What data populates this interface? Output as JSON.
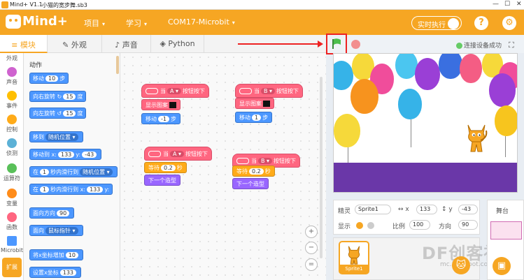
{
  "window": {
    "app_name": "Mind+ V1.1",
    "file_name": "小猫的宽步舞.sb3",
    "min": "—",
    "max": "☐",
    "close": "✕"
  },
  "menubar": {
    "logo": "Mind+",
    "items": [
      {
        "label": "项目",
        "caret": "▾"
      },
      {
        "label": "学习",
        "caret": "▾"
      },
      {
        "label": "COM17-Microbit",
        "caret": "▾"
      }
    ],
    "realtime_label": "实时执行",
    "help": "?",
    "settings": "⚙"
  },
  "tabs": [
    {
      "label": "模块",
      "icon": "≡"
    },
    {
      "label": "外观",
      "icon": "✎"
    },
    {
      "label": "声音",
      "icon": "♪"
    },
    {
      "label": "Python",
      "icon": "◈"
    }
  ],
  "stage_toolbar": {
    "connected": "连接设备成功",
    "fullscreen": "⛶"
  },
  "categories": [
    {
      "label": "外观",
      "color": "#9966ff"
    },
    {
      "label": "声音",
      "color": "#cf63cf"
    },
    {
      "label": "事件",
      "color": "#ffbf00"
    },
    {
      "label": "控制",
      "color": "#ffab19"
    },
    {
      "label": "侦测",
      "color": "#5cb1d6"
    },
    {
      "label": "运算符",
      "color": "#59c059"
    },
    {
      "label": "变量",
      "color": "#ff8c1a"
    },
    {
      "label": "函数",
      "color": "#ff6680"
    },
    {
      "label": "Microbit",
      "color": "#4c97ff"
    }
  ],
  "expand_label": "扩展",
  "palette": {
    "title": "动作",
    "blocks": [
      {
        "pre": "移动",
        "val": "10",
        "post": "步"
      },
      {
        "pre": "向右旋转 ↻",
        "val": "15",
        "post": "度"
      },
      {
        "pre": "向左旋转 ↺",
        "val": "15",
        "post": "度"
      },
      {
        "pre": "移到",
        "dd": "随机位置 ▾"
      },
      {
        "pre": "移动到 x:",
        "val": "133",
        "post": "y:",
        "val2": "-43"
      },
      {
        "pre": "在",
        "val": "1",
        "post": "秒内滑行到",
        "dd": "随机位置 ▾"
      },
      {
        "pre": "在",
        "val": "1",
        "post": "秒内滑行到 x:",
        "val2": "133",
        "post2": "y:"
      },
      {
        "pre": "面向方向",
        "val": "90"
      },
      {
        "pre": "面向",
        "dd": "鼠标指针 ▾"
      },
      {
        "pre": "将x坐标增加",
        "val": "10"
      },
      {
        "pre": "设置x坐标",
        "val": "133"
      }
    ]
  },
  "scripts": [
    {
      "hat": {
        "pre": "当",
        "key": "A ▾",
        "post": "按钮按下"
      },
      "show": "显示图案",
      "move": {
        "pre": "移动",
        "val": "-1",
        "post": "步"
      }
    },
    {
      "hat": {
        "pre": "当",
        "key": "B ▾",
        "post": "按钮按下"
      },
      "show": "显示图案",
      "move": {
        "pre": "移动",
        "val": "1",
        "post": "步"
      }
    },
    {
      "hat": {
        "pre": "当",
        "key": "A ▾",
        "post": "按钮按下"
      },
      "wait": {
        "pre": "等待",
        "val": "0.2",
        "post": "秒"
      },
      "next": "下一个造型"
    },
    {
      "hat": {
        "pre": "当",
        "key": "B ▾",
        "post": "按钮按下"
      },
      "wait": {
        "pre": "等待",
        "val": "0.2",
        "post": "秒"
      },
      "next": "下一个造型"
    }
  ],
  "zoom": {
    "in": "+",
    "out": "−",
    "reset": "="
  },
  "sprite_info": {
    "sprite_label": "精灵",
    "sprite_name": "Sprite1",
    "x_label": "↔ x",
    "x": "133",
    "y_label": "↕ y",
    "y": "-43",
    "show_label": "显示",
    "size_label": "比例",
    "size": "100",
    "dir_label": "方向",
    "dir": "90"
  },
  "sprite_thumb": "Sprite1",
  "stage_panel": {
    "title": "舞台"
  },
  "watermark": {
    "main": "DF创客社区",
    "sub": "mc.DFRobot.com.cn"
  }
}
